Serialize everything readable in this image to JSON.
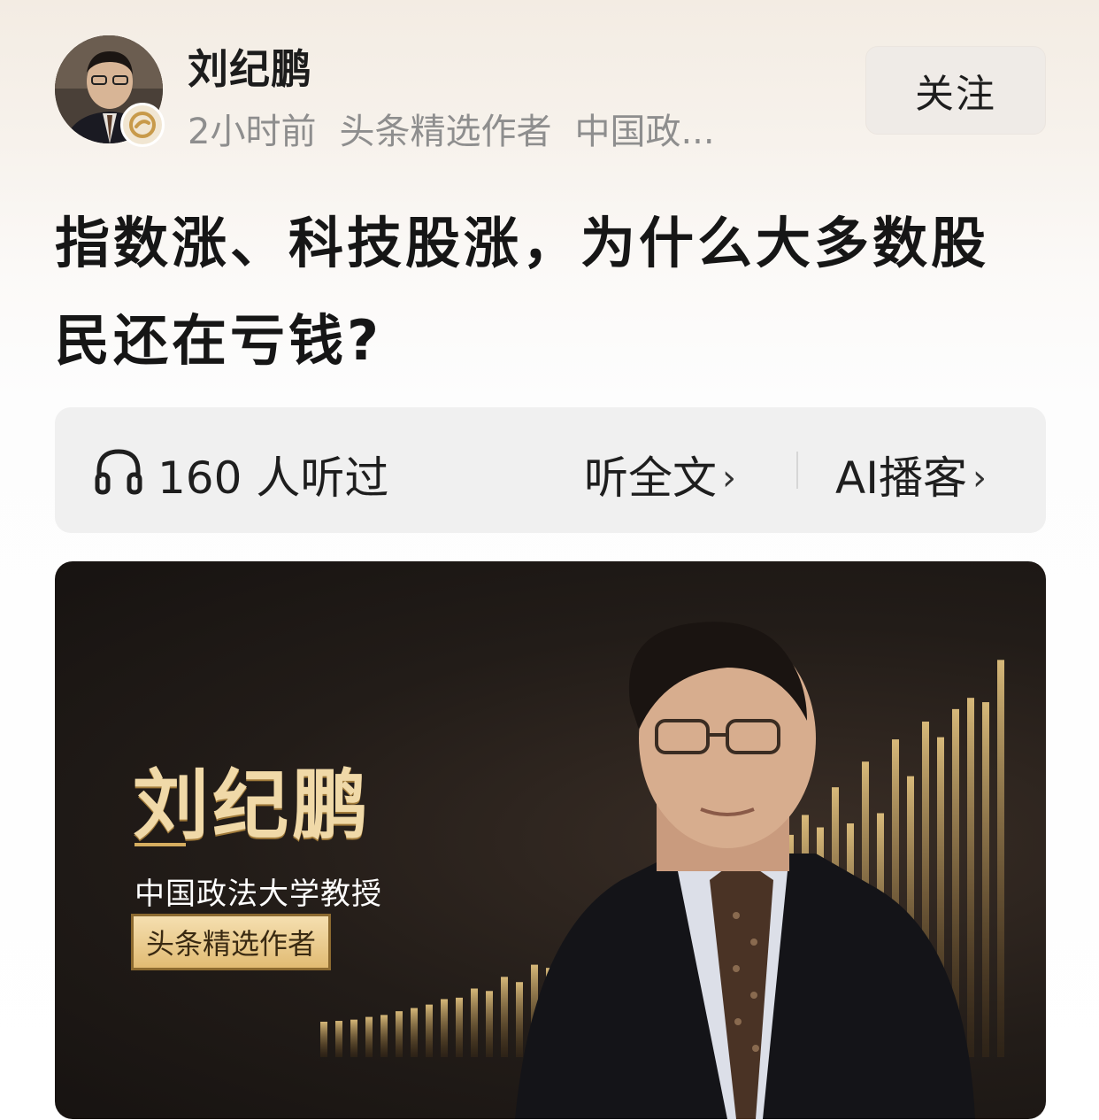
{
  "author": {
    "name": "刘纪鹏",
    "time": "2小时前",
    "tag": "头条精选作者",
    "org": "中国政..."
  },
  "follow_label": "关注",
  "article": {
    "title": "指数涨、科技股涨，为什么大多数股民还在亏钱?"
  },
  "listen": {
    "count_text": "160 人听过",
    "full_text": "听全文",
    "ai_podcast": "AI播客",
    "chevron": "›"
  },
  "banner": {
    "name": "刘纪鹏",
    "subtitle": "中国政法大学教授",
    "badge": "头条精选作者",
    "accent": "#d6ae60"
  },
  "icons": {
    "headphones": "headphones-icon",
    "verify": "verified-badge-icon"
  }
}
